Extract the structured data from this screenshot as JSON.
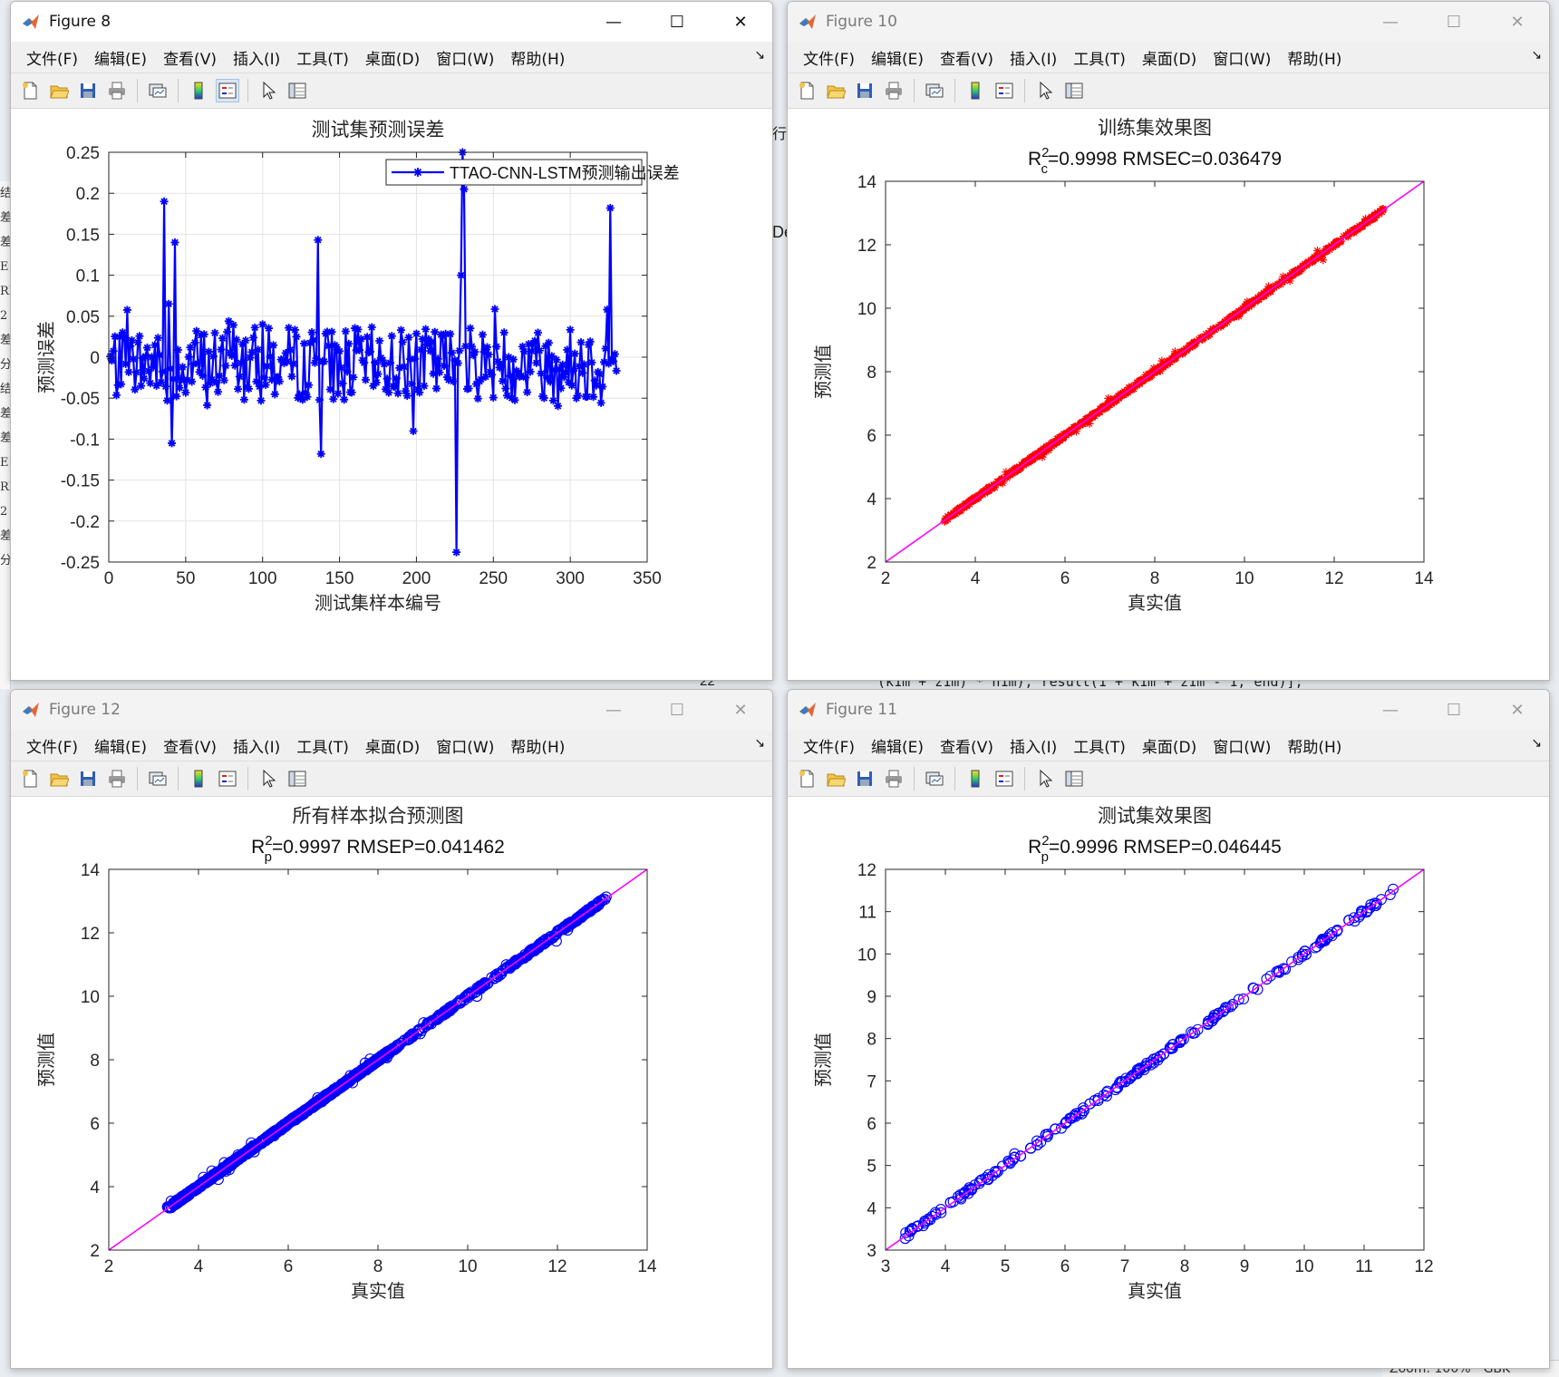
{
  "background": {
    "code_line": "(k1m + z1m) * n1m), result(1 + k1m + z1m - 1, end)];",
    "line_number": "22",
    "left_chars": [
      "结",
      "差",
      "差",
      "E",
      "RI",
      "2",
      "差",
      "分",
      "结",
      "差",
      "差",
      "E",
      "RI",
      "2",
      "差",
      "分"
    ],
    "mid_frag": "De",
    "mid_frag2": "行",
    "status_zoom": "Zoom: 100%",
    "status_enc": "GBK"
  },
  "windows": {
    "fig8": {
      "title": "Figure 8",
      "menus": [
        "文件(F)",
        "编辑(E)",
        "查看(V)",
        "插入(I)",
        "工具(T)",
        "桌面(D)",
        "窗口(W)",
        "帮助(H)"
      ],
      "controls": {
        "min": "—",
        "max": "☐",
        "close": "✕"
      }
    },
    "fig10": {
      "title": "Figure 10",
      "menus": [
        "文件(F)",
        "编辑(E)",
        "查看(V)",
        "插入(I)",
        "工具(T)",
        "桌面(D)",
        "窗口(W)",
        "帮助(H)"
      ],
      "controls": {
        "min": "—",
        "max": "☐",
        "close": "✕"
      }
    },
    "fig12": {
      "title": "Figure 12",
      "menus": [
        "文件(F)",
        "编辑(E)",
        "查看(V)",
        "插入(I)",
        "工具(T)",
        "桌面(D)",
        "窗口(W)",
        "帮助(H)"
      ],
      "controls": {
        "min": "—",
        "max": "☐",
        "close": "✕"
      }
    },
    "fig11": {
      "title": "Figure 11",
      "menus": [
        "文件(F)",
        "编辑(E)",
        "查看(V)",
        "插入(I)",
        "工具(T)",
        "桌面(D)",
        "窗口(W)",
        "帮助(H)"
      ],
      "controls": {
        "min": "—",
        "max": "☐",
        "close": "✕"
      }
    }
  },
  "toolbar_icons": [
    "new-file-icon",
    "open-folder-icon",
    "save-icon",
    "print-icon",
    "link-plot-icon",
    "colorbar-icon",
    "legend-icon",
    "pointer-icon",
    "property-inspector-icon"
  ],
  "chart_data": [
    {
      "figure": "Figure 8",
      "type": "line",
      "title": "测试集预测误差",
      "xlabel": "测试集样本编号",
      "ylabel": "预测误差",
      "xlim": [
        0,
        350
      ],
      "ylim": [
        -0.25,
        0.25
      ],
      "xticks": [
        0,
        50,
        100,
        150,
        200,
        250,
        300,
        350
      ],
      "yticks": [
        -0.25,
        -0.2,
        -0.15,
        -0.1,
        -0.05,
        0,
        0.05,
        0.1,
        0.15,
        0.2,
        0.25
      ],
      "ytick_labels": [
        "-0.25",
        "-0.2",
        "-0.15",
        "-0.1",
        "-0.05",
        "0",
        "0.05",
        "0.1",
        "0.15",
        "0.2",
        "0.25"
      ],
      "grid": true,
      "legend": "top-right",
      "color": "#0000ff",
      "marker": "*",
      "series": [
        {
          "name": "TTAO-CNN-LSTM预测输出误差",
          "n": 330
        }
      ],
      "highlights": [
        {
          "x": 36,
          "y": 0.19
        },
        {
          "x": 39,
          "y": 0.065
        },
        {
          "x": 41,
          "y": -0.105
        },
        {
          "x": 43,
          "y": 0.14
        },
        {
          "x": 136,
          "y": 0.143
        },
        {
          "x": 138,
          "y": -0.118
        },
        {
          "x": 226,
          "y": -0.238
        },
        {
          "x": 229,
          "y": 0.1
        },
        {
          "x": 230,
          "y": 0.25
        },
        {
          "x": 231,
          "y": 0.205
        },
        {
          "x": 324,
          "y": 0.058
        },
        {
          "x": 326,
          "y": 0.182
        }
      ]
    },
    {
      "figure": "Figure 10",
      "type": "scatter",
      "title": "训练集效果图",
      "subtitle": "R_c^2=0.9998  RMSEC=0.036479",
      "subtitle_parts": {
        "r": "R",
        "sup": "2",
        "sub": "c",
        "rest": "=0.9998  RMSEC=0.036479"
      },
      "xlabel": "真实值",
      "ylabel": "预测值",
      "xlim": [
        2,
        14
      ],
      "ylim": [
        2,
        14
      ],
      "xticks": [
        2,
        4,
        6,
        8,
        10,
        12,
        14
      ],
      "yticks": [
        2,
        4,
        6,
        8,
        10,
        12,
        14
      ],
      "marker": "*",
      "marker_color": "#ff0000",
      "line_color": "#ff00ff",
      "range": [
        3.3,
        13.1
      ],
      "n": 900
    },
    {
      "figure": "Figure 12",
      "type": "scatter",
      "title": "所有样本拟合预测图",
      "subtitle": "R_p^2=0.9997  RMSEP=0.041462",
      "subtitle_parts": {
        "r": "R",
        "sup": "2",
        "sub": "p",
        "rest": "=0.9997  RMSEP=0.041462"
      },
      "xlabel": "真实值",
      "ylabel": "预测值",
      "xlim": [
        2,
        14
      ],
      "ylim": [
        2,
        14
      ],
      "xticks": [
        2,
        4,
        6,
        8,
        10,
        12,
        14
      ],
      "yticks": [
        2,
        4,
        6,
        8,
        10,
        12,
        14
      ],
      "marker": "o",
      "marker_color": "#0000ff",
      "line_color": "#ff00ff",
      "range": [
        3.3,
        13.1
      ],
      "n": 1100
    },
    {
      "figure": "Figure 11",
      "type": "scatter",
      "title": "测试集效果图",
      "subtitle": "R_p^2=0.9996  RMSEP=0.046445",
      "subtitle_parts": {
        "r": "R",
        "sup": "2",
        "sub": "p",
        "rest": "=0.9996  RMSEP=0.046445"
      },
      "xlabel": "真实值",
      "ylabel": "预测值",
      "xlim": [
        3,
        12
      ],
      "ylim": [
        3,
        12
      ],
      "xticks": [
        3,
        4,
        5,
        6,
        7,
        8,
        9,
        10,
        11,
        12
      ],
      "yticks": [
        3,
        4,
        5,
        6,
        7,
        8,
        9,
        10,
        11,
        12
      ],
      "marker": "o",
      "marker_color": "#0000ff",
      "line_color": "#ff00ff",
      "range": [
        3.3,
        11.5
      ],
      "n": 330
    }
  ]
}
